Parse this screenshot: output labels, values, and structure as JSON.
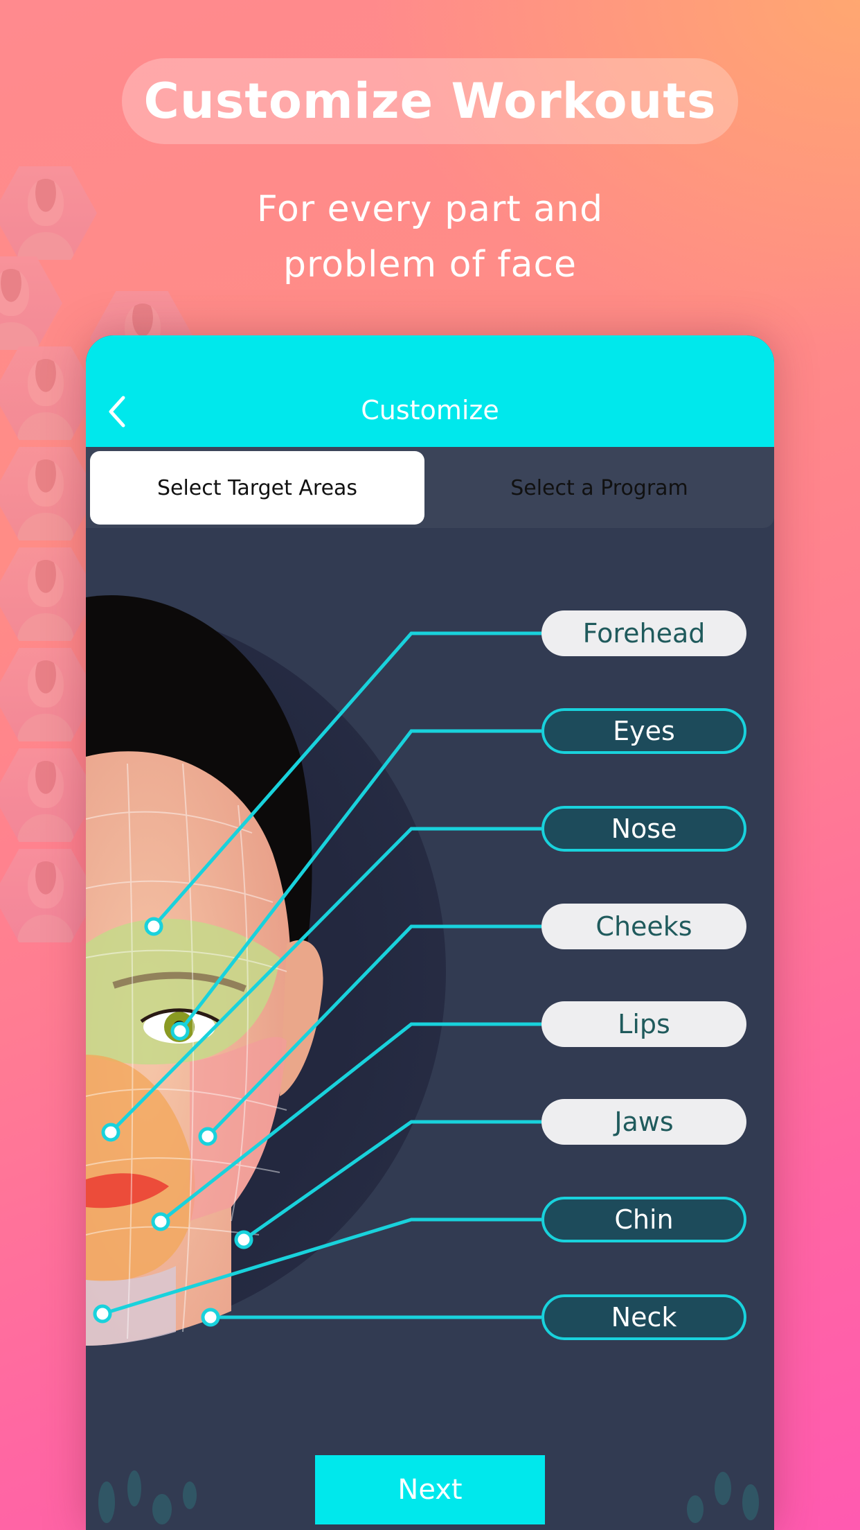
{
  "promo": {
    "headline": "Customize Workouts",
    "subtitle_line1": "For every part and",
    "subtitle_line2": "problem of face"
  },
  "app": {
    "nav": {
      "title": "Customize",
      "back_icon": "chevron-left-icon"
    },
    "tabs": [
      {
        "label": "Select Target Areas",
        "active": true
      },
      {
        "label": "Select a Program",
        "active": false
      }
    ],
    "target_areas": [
      {
        "label": "Forehead",
        "selected": false
      },
      {
        "label": "Eyes",
        "selected": true
      },
      {
        "label": "Nose",
        "selected": true
      },
      {
        "label": "Cheeks",
        "selected": false
      },
      {
        "label": "Lips",
        "selected": false
      },
      {
        "label": "Jaws",
        "selected": false
      },
      {
        "label": "Chin",
        "selected": true
      },
      {
        "label": "Neck",
        "selected": true
      }
    ],
    "next_button": "Next"
  },
  "colors": {
    "accent": "#00E8EC",
    "panel": "#323B52",
    "selected_pill": "#1D4B5B",
    "selected_border": "#19D2DC",
    "unselected_pill": "#EEEEF0",
    "unselected_text": "#1F5A5C"
  }
}
